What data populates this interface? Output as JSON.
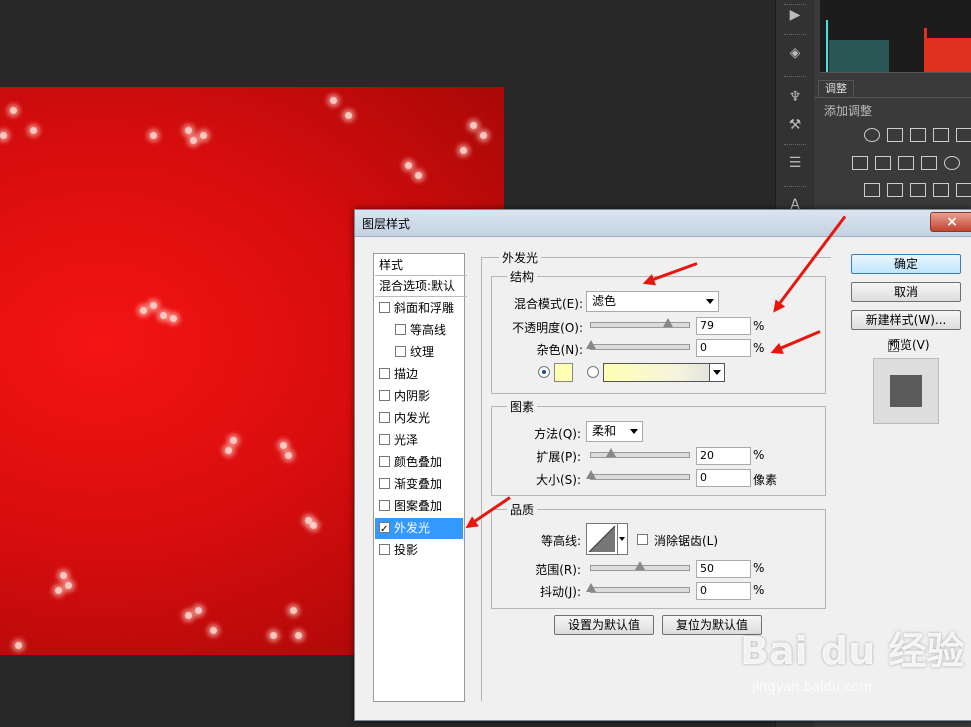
{
  "right_panel": {
    "adjust_tab": "调整",
    "add_adjustment": "添加调整"
  },
  "dialog": {
    "title": "图层样式",
    "close_icon": "×",
    "style_list": {
      "header": "样式",
      "blend_options": "混合选项:默认",
      "items": [
        {
          "label": "斜面和浮雕",
          "checked": false,
          "indent": false
        },
        {
          "label": "等高线",
          "checked": false,
          "indent": true
        },
        {
          "label": "纹理",
          "checked": false,
          "indent": true
        },
        {
          "label": "描边",
          "checked": false,
          "indent": false
        },
        {
          "label": "内阴影",
          "checked": false,
          "indent": false
        },
        {
          "label": "内发光",
          "checked": false,
          "indent": false
        },
        {
          "label": "光泽",
          "checked": false,
          "indent": false
        },
        {
          "label": "颜色叠加",
          "checked": false,
          "indent": false
        },
        {
          "label": "渐变叠加",
          "checked": false,
          "indent": false
        },
        {
          "label": "图案叠加",
          "checked": false,
          "indent": false
        },
        {
          "label": "外发光",
          "checked": true,
          "indent": false,
          "selected": true
        },
        {
          "label": "投影",
          "checked": false,
          "indent": false
        }
      ]
    },
    "outer_glow": {
      "group_title": "外发光",
      "structure": {
        "title": "结构",
        "blend_mode_label": "混合模式(E):",
        "blend_mode_value": "滤色",
        "opacity_label": "不透明度(O):",
        "opacity_value": "79",
        "opacity_pct": 79,
        "noise_label": "杂色(N):",
        "noise_value": "0",
        "noise_pct": 0,
        "percent": "%",
        "glow_color": "#ffffb3"
      },
      "elements": {
        "title": "图素",
        "method_label": "方法(Q):",
        "method_value": "柔和",
        "spread_label": "扩展(P):",
        "spread_value": "20",
        "spread_pct": 20,
        "size_label": "大小(S):",
        "size_value": "0",
        "size_pct": 0,
        "percent": "%",
        "pixels": "像素"
      },
      "quality": {
        "title": "品质",
        "contour_label": "等高线:",
        "antialias_label": "消除锯齿(L)",
        "range_label": "范围(R):",
        "range_value": "50",
        "range_pct": 50,
        "jitter_label": "抖动(J):",
        "jitter_value": "0",
        "jitter_pct": 0,
        "percent": "%"
      },
      "make_default": "设置为默认值",
      "reset_default": "复位为默认值"
    },
    "buttons": {
      "ok": "确定",
      "cancel": "取消",
      "new_style": "新建样式(W)...",
      "preview": "预览(V)"
    }
  },
  "watermark": {
    "text": "Bai du 经验",
    "url": "jingyan.baidu.com"
  }
}
